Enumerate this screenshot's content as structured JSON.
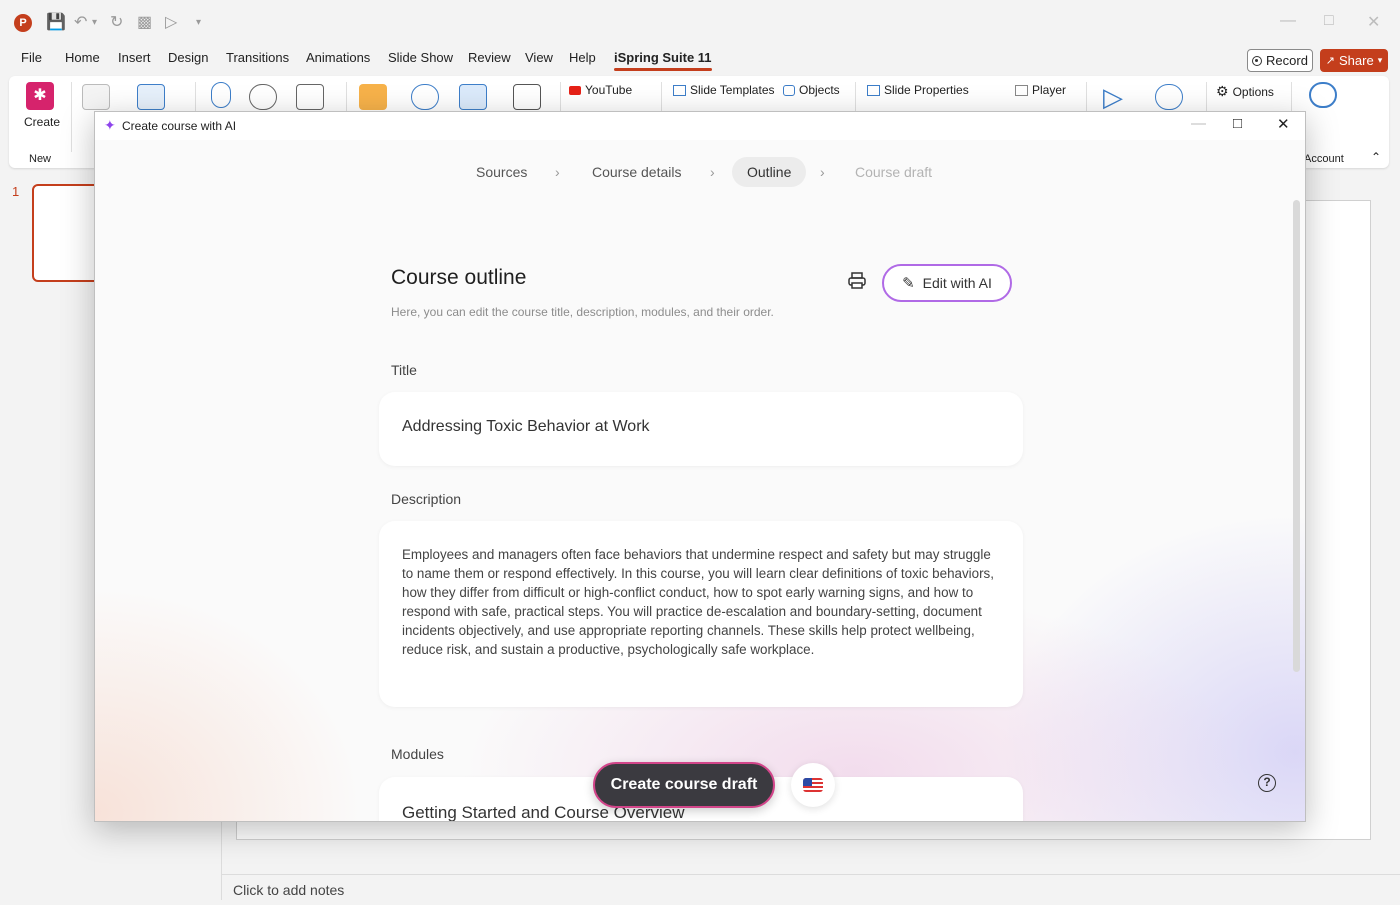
{
  "ribbon_tabs": [
    "File",
    "Home",
    "Insert",
    "Design",
    "Transitions",
    "Animations",
    "Slide Show",
    "Review",
    "View",
    "Help",
    "iSpring Suite 11"
  ],
  "record_label": "Record",
  "share_label": "Share",
  "ribbon": {
    "create_label": "Create",
    "new_group_label": "New",
    "youtube_label": "YouTube",
    "slide_templates_label": "Slide Templates",
    "objects_label": "Objects",
    "slide_properties_label": "Slide Properties",
    "player_label": "Player",
    "options_label": "Options",
    "account_label": "Account"
  },
  "slide_number": "1",
  "notes_placeholder": "Click to add notes",
  "dialog": {
    "title": "Create course with AI",
    "steps": [
      {
        "label": "Sources",
        "state": "done"
      },
      {
        "label": "Course details",
        "state": "done"
      },
      {
        "label": "Outline",
        "state": "active"
      },
      {
        "label": "Course draft",
        "state": "disabled"
      }
    ],
    "heading": "Course outline",
    "subheading": "Here, you can edit the course title, description, modules, and their order.",
    "edit_ai_label": "Edit with AI",
    "title_label": "Title",
    "title_value": "Addressing Toxic Behavior at Work",
    "description_label": "Description",
    "description_value": "Employees and managers often face behaviors that undermine respect and safety but may struggle to name them or respond effectively. In this course, you will learn clear definitions of toxic behaviors, how they differ from difficult or high-conflict conduct, how to spot early warning signs, and how to respond with safe, practical steps. You will practice de-escalation and boundary-setting, document incidents objectively, and use appropriate reporting channels. These skills help protect wellbeing, reduce risk, and sustain a productive, psychologically safe workplace.",
    "modules_label": "Modules",
    "modules": [
      "Getting Started and Course Overview"
    ],
    "create_button": "Create course draft",
    "language_flag": "us-flag-icon",
    "accent_color": "#b06ae6"
  }
}
